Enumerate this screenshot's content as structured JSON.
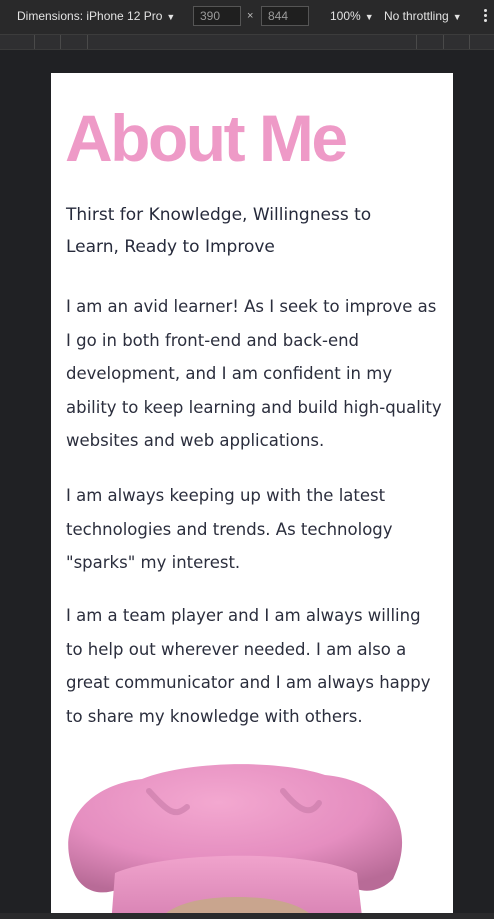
{
  "devtools": {
    "dimensions_label": "Dimensions: iPhone 12 Pro",
    "width_value": "390",
    "height_value": "844",
    "times_symbol": "×",
    "zoom": "100%",
    "throttling": "No throttling",
    "caret": "▼"
  },
  "page": {
    "title": "About Me",
    "subtitle": "Thirst for Knowledge, Willingness to Learn, Ready to Improve",
    "paragraphs": [
      "I am an avid learner! As I seek to improve as I go in both front-end and back-end development, and I am confident in my ability to keep learning and build high-quality websites and web applications.",
      "I am always keeping up with the latest technologies and trends. As technology \"sparks\" my interest.",
      "I am a team player and I am always willing to help out wherever needed. I am also a great communicator and I am always happy to share my knowledge with others."
    ]
  },
  "colors": {
    "title": "#ee9ac7",
    "text": "#2b2e3d",
    "hat": "#e58ec0",
    "devtools_bg": "#202124"
  },
  "icons": {
    "dropdown": "caret-down-icon",
    "menu": "more-vertical-icon"
  }
}
